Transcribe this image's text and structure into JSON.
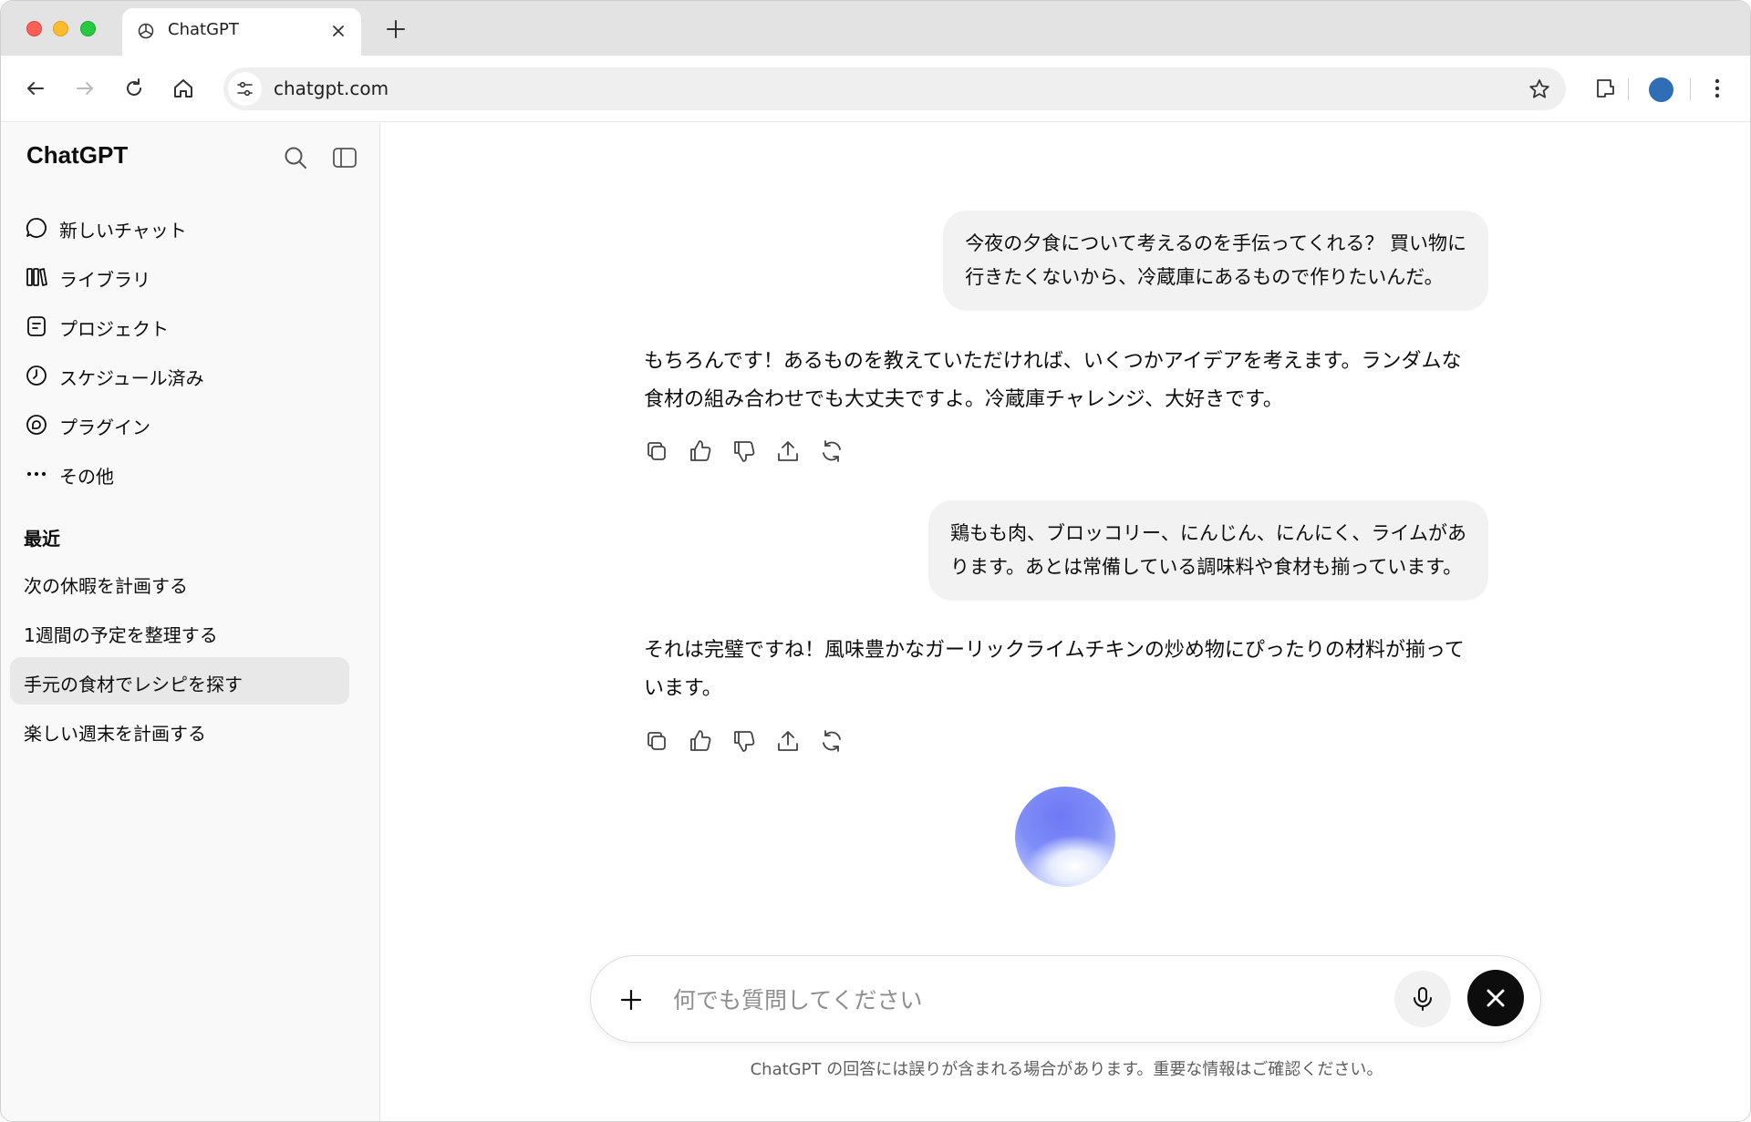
{
  "browser": {
    "tab_title": "ChatGPT",
    "url": "chatgpt.com"
  },
  "sidebar": {
    "brand": "ChatGPT",
    "nav_items": [
      {
        "label": "新しいチャット",
        "icon": "chat-bubble-icon"
      },
      {
        "label": "ライブラリ",
        "icon": "library-icon"
      },
      {
        "label": "プロジェクト",
        "icon": "project-icon"
      },
      {
        "label": "スケジュール済み",
        "icon": "clock-icon"
      },
      {
        "label": "プラグイン",
        "icon": "plugin-icon"
      },
      {
        "label": "その他",
        "icon": "more-dots-icon"
      }
    ],
    "recent_heading": "最近",
    "recent_items": [
      {
        "label": "次の休暇を計画する",
        "active": false
      },
      {
        "label": "1週間の予定を整理する",
        "active": false
      },
      {
        "label": "手元の食材でレシピを探す",
        "active": true
      },
      {
        "label": "楽しい週末を計画する",
        "active": false
      }
    ]
  },
  "conversation": {
    "user_1": [
      "今夜の夕食について考えるのを手伝ってくれる？ 買い物に",
      "行きたくないから、冷蔵庫にあるもので作りたいんだ。"
    ],
    "assistant_1": "もちろんです！あるものを教えていただければ、いくつかアイデアを考えます。ランダムな食材の組み合わせでも大丈夫ですよ。冷蔵庫チャレンジ、大好きです。",
    "user_2": [
      "鶏もも肉、ブロッコリー、にんじん、にんにく、ライムがあ",
      "ります。あとは常備している調味料や食材も揃っています。"
    ],
    "assistant_2": "それは完璧ですね！風味豊かなガーリックライムチキンの炒め物にぴったりの材料が揃っています。"
  },
  "composer": {
    "placeholder": "何でも質問してください"
  },
  "disclaimer": "ChatGPT の回答には誤りが含まれる場合があります。重要な情報はご確認ください。",
  "colors": {
    "accent_profile": "#2f6db5",
    "active_item_bg": "#e8e8e8",
    "bubble_bg": "#f2f2f2"
  }
}
